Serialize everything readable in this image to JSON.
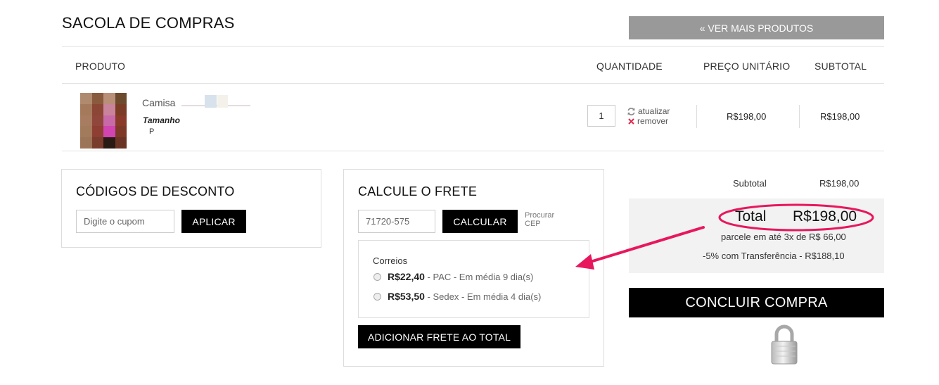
{
  "header": {
    "title": "SACOLA DE COMPRAS",
    "more_products": "« VER MAIS PRODUTOS"
  },
  "table": {
    "columns": [
      "PRODUTO",
      "QUANTIDADE",
      "PREÇO UNITÁRIO",
      "SUBTOTAL"
    ],
    "item": {
      "name": "Camisa",
      "size_label": "Tamanho",
      "size_value": "P",
      "quantity": "1",
      "update_label": "atualizar",
      "remove_label": "remover",
      "unit_price": "R$198,00",
      "subtotal": "R$198,00"
    }
  },
  "discount": {
    "title": "CÓDIGOS DE DESCONTO",
    "placeholder": "Digite o cupom",
    "apply_label": "APLICAR"
  },
  "shipping": {
    "title": "CALCULE O FRETE",
    "cep_value": "71720-575",
    "calc_label": "CALCULAR",
    "find_cep_line1": "Procurar",
    "find_cep_line2": "CEP",
    "carrier": "Correios",
    "options": [
      {
        "price": "R$22,40",
        "desc": " - PAC - Em média 9 dia(s)"
      },
      {
        "price": "R$53,50",
        "desc": " - Sedex - Em média 4 dia(s)"
      }
    ],
    "add_label": "ADICIONAR FRETE AO TOTAL"
  },
  "summary": {
    "subtotal_label": "Subtotal",
    "subtotal_value": "R$198,00",
    "total_label": "Total",
    "total_value": "R$198,00",
    "installments": "parcele em até 3x de R$ 66,00",
    "transfer": "-5% com Transferência - R$188,10",
    "checkout_label": "CONCLUIR COMPRA"
  },
  "colors": {
    "annotation": "#e8175d",
    "gray_button": "#999999",
    "black_button": "#000000"
  }
}
